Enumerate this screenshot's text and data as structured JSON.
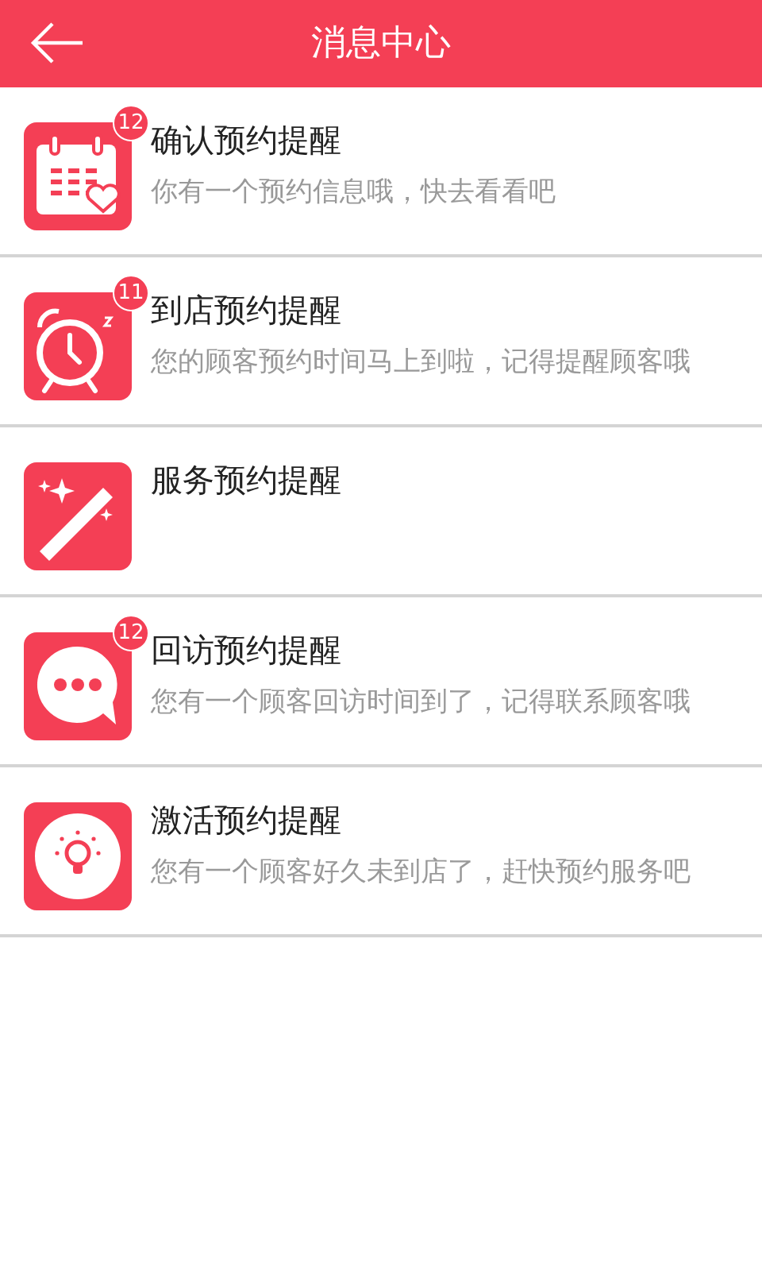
{
  "header": {
    "title": "消息中心"
  },
  "items": [
    {
      "kind": "calendar",
      "title": "确认预约提醒",
      "subtitle": "你有一个预约信息哦，快去看看吧",
      "badge": "12"
    },
    {
      "kind": "alarm",
      "title": "到店预约提醒",
      "subtitle": "您的顾客预约时间马上到啦，记得提醒顾客哦",
      "badge": "11"
    },
    {
      "kind": "wand",
      "title": "服务预约提醒"
    },
    {
      "kind": "chat",
      "title": "回访预约提醒",
      "subtitle": "您有一个顾客回访时间到了，记得联系顾客哦",
      "badge": "12"
    },
    {
      "kind": "bulb",
      "title": "激活预约提醒",
      "subtitle": "您有一个顾客好久未到店了，赶快预约服务吧"
    }
  ]
}
